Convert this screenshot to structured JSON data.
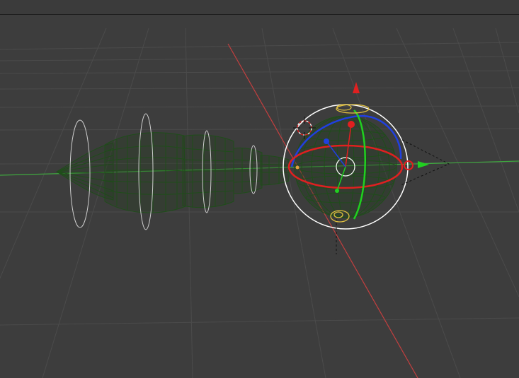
{
  "viewport": {
    "background": "#3d3d3d",
    "grid_color": "#4b4b4b",
    "x_axis_color": "#c33f3f",
    "y_axis_color": "#3fa83f"
  },
  "objects": {
    "tail_mesh": {
      "wire_color": "#1f4d1a",
      "ring_color": "#cfcfcf"
    },
    "head_sphere": {
      "wire_color": "#1f4d1a",
      "outline_color": "#f0f0f0"
    }
  },
  "gizmo": {
    "colors": {
      "x": "#e02020",
      "y": "#20d020",
      "z": "#2040e0",
      "view_ring": "#ffffff",
      "handle": "#e0c040"
    },
    "icons": {
      "z_arrow": "triangle-up",
      "y_arrow": "triangle-right",
      "cursor": "3d-cursor"
    }
  }
}
